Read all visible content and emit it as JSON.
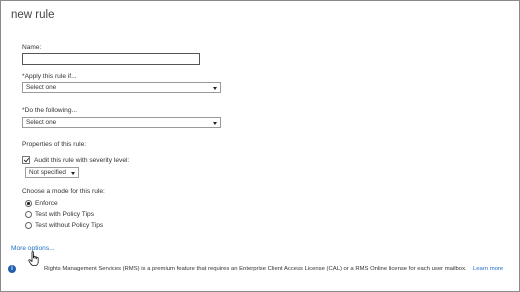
{
  "dialog": {
    "title": "new rule"
  },
  "name_field": {
    "label": "Name:",
    "value": ""
  },
  "apply_rule": {
    "label": "*Apply this rule if...",
    "selected": "Select one"
  },
  "do_following": {
    "label": "*Do the following...",
    "selected": "Select one"
  },
  "properties": {
    "label": "Properties of this rule:",
    "audit_label": "Audit this rule with severity level:",
    "audit_checked": true,
    "severity_selected": "Not specified"
  },
  "mode": {
    "label": "Choose a mode for this rule:",
    "options": [
      "Enforce",
      "Test with Policy Tips",
      "Test without Policy Tips"
    ],
    "selected_index": 0
  },
  "more_options": "More options...",
  "footer": {
    "info_text": "Rights Management Services (RMS) is a premium feature that requires an Enterprise Client Access License (CAL) or a RMS Online license for each user mailbox.",
    "learn_more": "Learn more"
  },
  "icons": [
    "info-icon",
    "hand-cursor-icon",
    "chevron-down-icon",
    "checkbox-checked-icon"
  ],
  "colors": {
    "link": "#1e6fc6",
    "info_icon": "#1f5fae"
  }
}
